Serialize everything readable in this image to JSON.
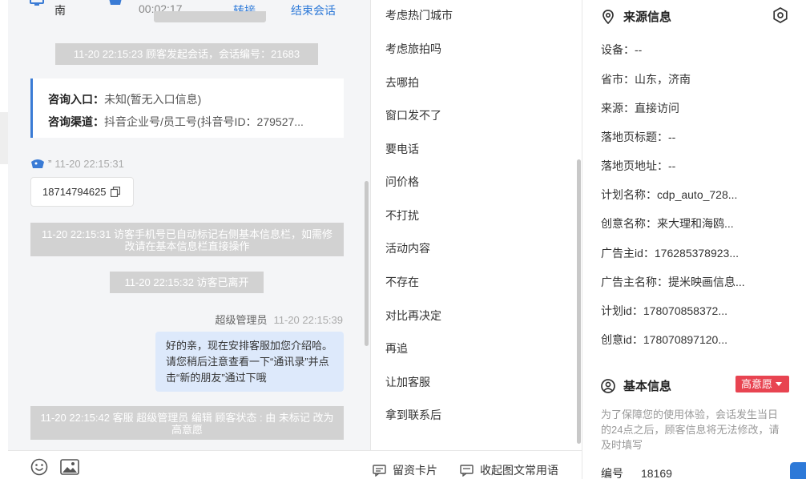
{
  "chat": {
    "header": {
      "visitor_name_fragment": "南",
      "timer": "00:02:17",
      "transfer": "转接",
      "end_session": "结束会话"
    },
    "system_start": "11-20 22:15:23 顾客发起会话，会话编号：21683",
    "entry": {
      "label_entry": "咨询入口：",
      "value_entry": "未知(暂无入口信息)",
      "label_channel": "咨询渠道：",
      "value_channel": "抖音企业号/员工号(抖音号ID：279527..."
    },
    "visitor_meta": {
      "name": "”",
      "time": "11-20 22:15:31"
    },
    "visitor_phone": "18714794625",
    "system_phone_marked": "11-20 22:15:31 访客手机号已自动标记右侧基本信息栏，如需修改请在基本信息栏直接操作",
    "system_left": "11-20 22:15:32 访客已离开",
    "agent_meta": {
      "name": "超级管理员",
      "time": "11-20 22:15:39"
    },
    "agent_message": "好的亲，现在安排客服加您介绍哈。请您稍后注意查看一下“通讯录”并点击“新的朋友”通过下哦",
    "system_status": "11-20 22:15:42 客服 超级管理员 编辑 顾客状态 : 由 未标记 改为 高意愿",
    "icons": {
      "emoji": "emoji-icon",
      "image": "image-icon",
      "copy": "copy-icon"
    }
  },
  "phrases": {
    "items": [
      "考虑热门城市",
      "考虑旅拍吗",
      "去哪拍",
      "窗口发不了",
      "要电话",
      "问价格",
      "不打扰",
      "活动内容",
      "不存在",
      "对比再决定",
      "再追",
      "让加客服",
      "拿到联系后"
    ],
    "footer": {
      "card": "留资卡片",
      "collapse": "收起图文常用语"
    }
  },
  "info": {
    "source": {
      "title": "来源信息",
      "rows": [
        "设备：--",
        "省市：山东，济南",
        "来源：直接访问",
        "落地页标题：--",
        "落地页地址：--",
        "计划名称：cdp_auto_728...",
        "创意名称：来大理和海鸥...",
        "广告主id：176285378923...",
        "广告主名称：提米映画信息...",
        "计划id：178070858372...",
        "创意id：178070897120..."
      ]
    },
    "basic": {
      "title": "基本信息",
      "status": "高意愿",
      "notice": "为了保障您的使用体验，会话发生当日的24点之后，顾客信息将无法修改，请及时填写",
      "id_label": "编号",
      "id_value": "18169"
    },
    "accent_color": "#2d79d8",
    "status_color": "#e84451"
  }
}
